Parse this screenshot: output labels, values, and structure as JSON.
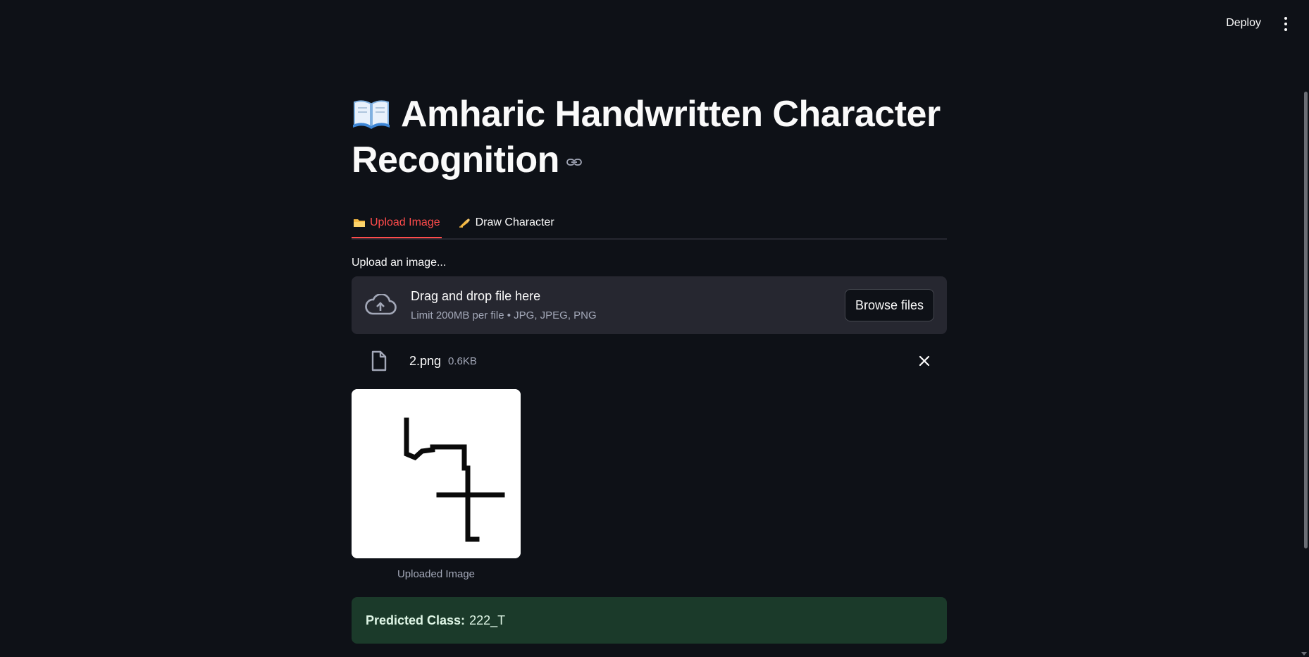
{
  "header": {
    "deploy_label": "Deploy"
  },
  "main": {
    "title": "Amharic Handwritten Character Recognition",
    "title_icon": "open-book-emoji",
    "tabs": [
      {
        "label": "Upload Image",
        "icon": "folder-emoji",
        "active": true
      },
      {
        "label": "Draw Character",
        "icon": "writing-hand-emoji",
        "active": false
      }
    ],
    "uploader": {
      "label": "Upload an image...",
      "drop_text": "Drag and drop file here",
      "limit_text": "Limit 200MB per file • JPG, JPEG, PNG",
      "browse_label": "Browse files"
    },
    "file": {
      "name": "2.png",
      "size": "0.6KB"
    },
    "image_caption": "Uploaded Image",
    "result": {
      "label": "Predicted Class:",
      "value": "222_T"
    }
  },
  "colors": {
    "background": "#0e1117",
    "accent": "#ff4b4b",
    "panel": "#262730",
    "success_bg": "#1b3a2a"
  }
}
